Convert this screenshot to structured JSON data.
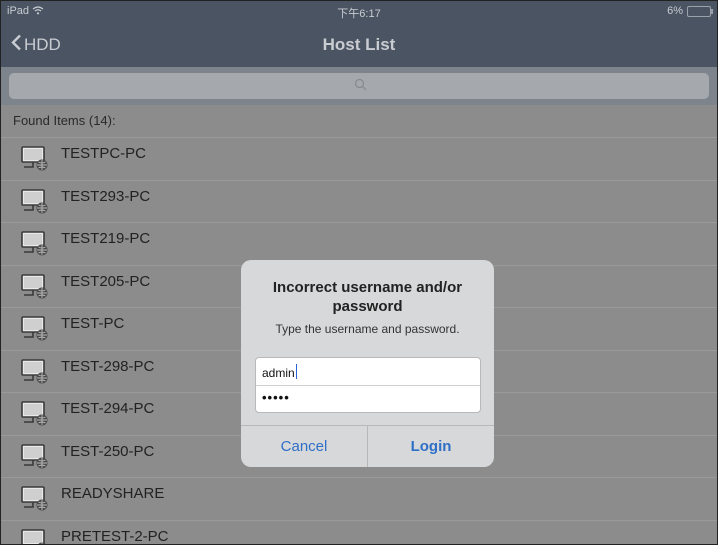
{
  "status": {
    "device": "iPad",
    "time": "下午6:17",
    "battery": "6%"
  },
  "nav": {
    "back_label": "HDD",
    "title": "Host List"
  },
  "search": {
    "placeholder": ""
  },
  "list": {
    "header": "Found Items (14):",
    "items": [
      "TESTPC-PC",
      "TEST293-PC",
      "TEST219-PC",
      "TEST205-PC",
      "TEST-PC",
      "TEST-298-PC",
      "TEST-294-PC",
      "TEST-250-PC",
      "READYSHARE",
      "PRETEST-2-PC"
    ]
  },
  "dialog": {
    "title": "Incorrect username and/or password",
    "message": "Type the username and password.",
    "username_value": "admin",
    "password_value": "•••••",
    "cancel_label": "Cancel",
    "login_label": "Login"
  },
  "colors": {
    "navbar": "#4a5462",
    "dim_overlay": "#8c8c8c",
    "dialog_bg": "#d7d8d9",
    "button_text": "#2e6fc8"
  },
  "icons": {
    "back": "chevron-left-icon",
    "search": "search-icon",
    "host": "network-computer-icon",
    "wifi": "wifi-icon",
    "battery": "battery-icon"
  }
}
